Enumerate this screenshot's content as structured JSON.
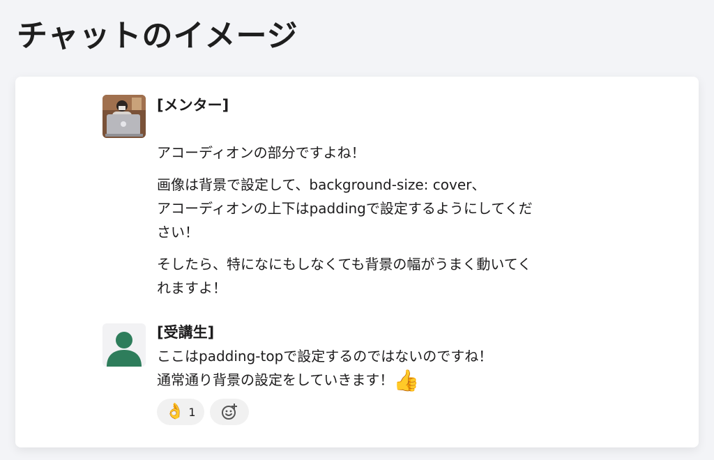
{
  "page": {
    "title": "チャットのイメージ"
  },
  "messages": [
    {
      "sender": "[メンター]",
      "avatar": "mentor-photo",
      "paragraphs": [
        "アコーディオンの部分ですよね！",
        "画像は背景で設定して、background-size: cover、\nアコーディオンの上下はpaddingで設定するようにしてくだ\nさい！",
        "そしたら、特になにもしなくても背景の幅がうまく動いてく\nれますよ！"
      ]
    },
    {
      "sender": "[受講生]",
      "avatar": "default-user-avatar",
      "paragraphs": [
        "ここはpadding-topで設定するのではないのですね！\n通常通り背景の設定をしていきます！"
      ],
      "trailing_emoji": "👍",
      "reactions": [
        {
          "emoji": "👌",
          "count": "1"
        }
      ],
      "add_reaction_icon": "add-emoji-icon"
    }
  ],
  "colors": {
    "background": "#f3f4f7",
    "card": "#ffffff",
    "avatar_green": "#2e7d5b",
    "reaction_bg": "#f1f1f1"
  }
}
